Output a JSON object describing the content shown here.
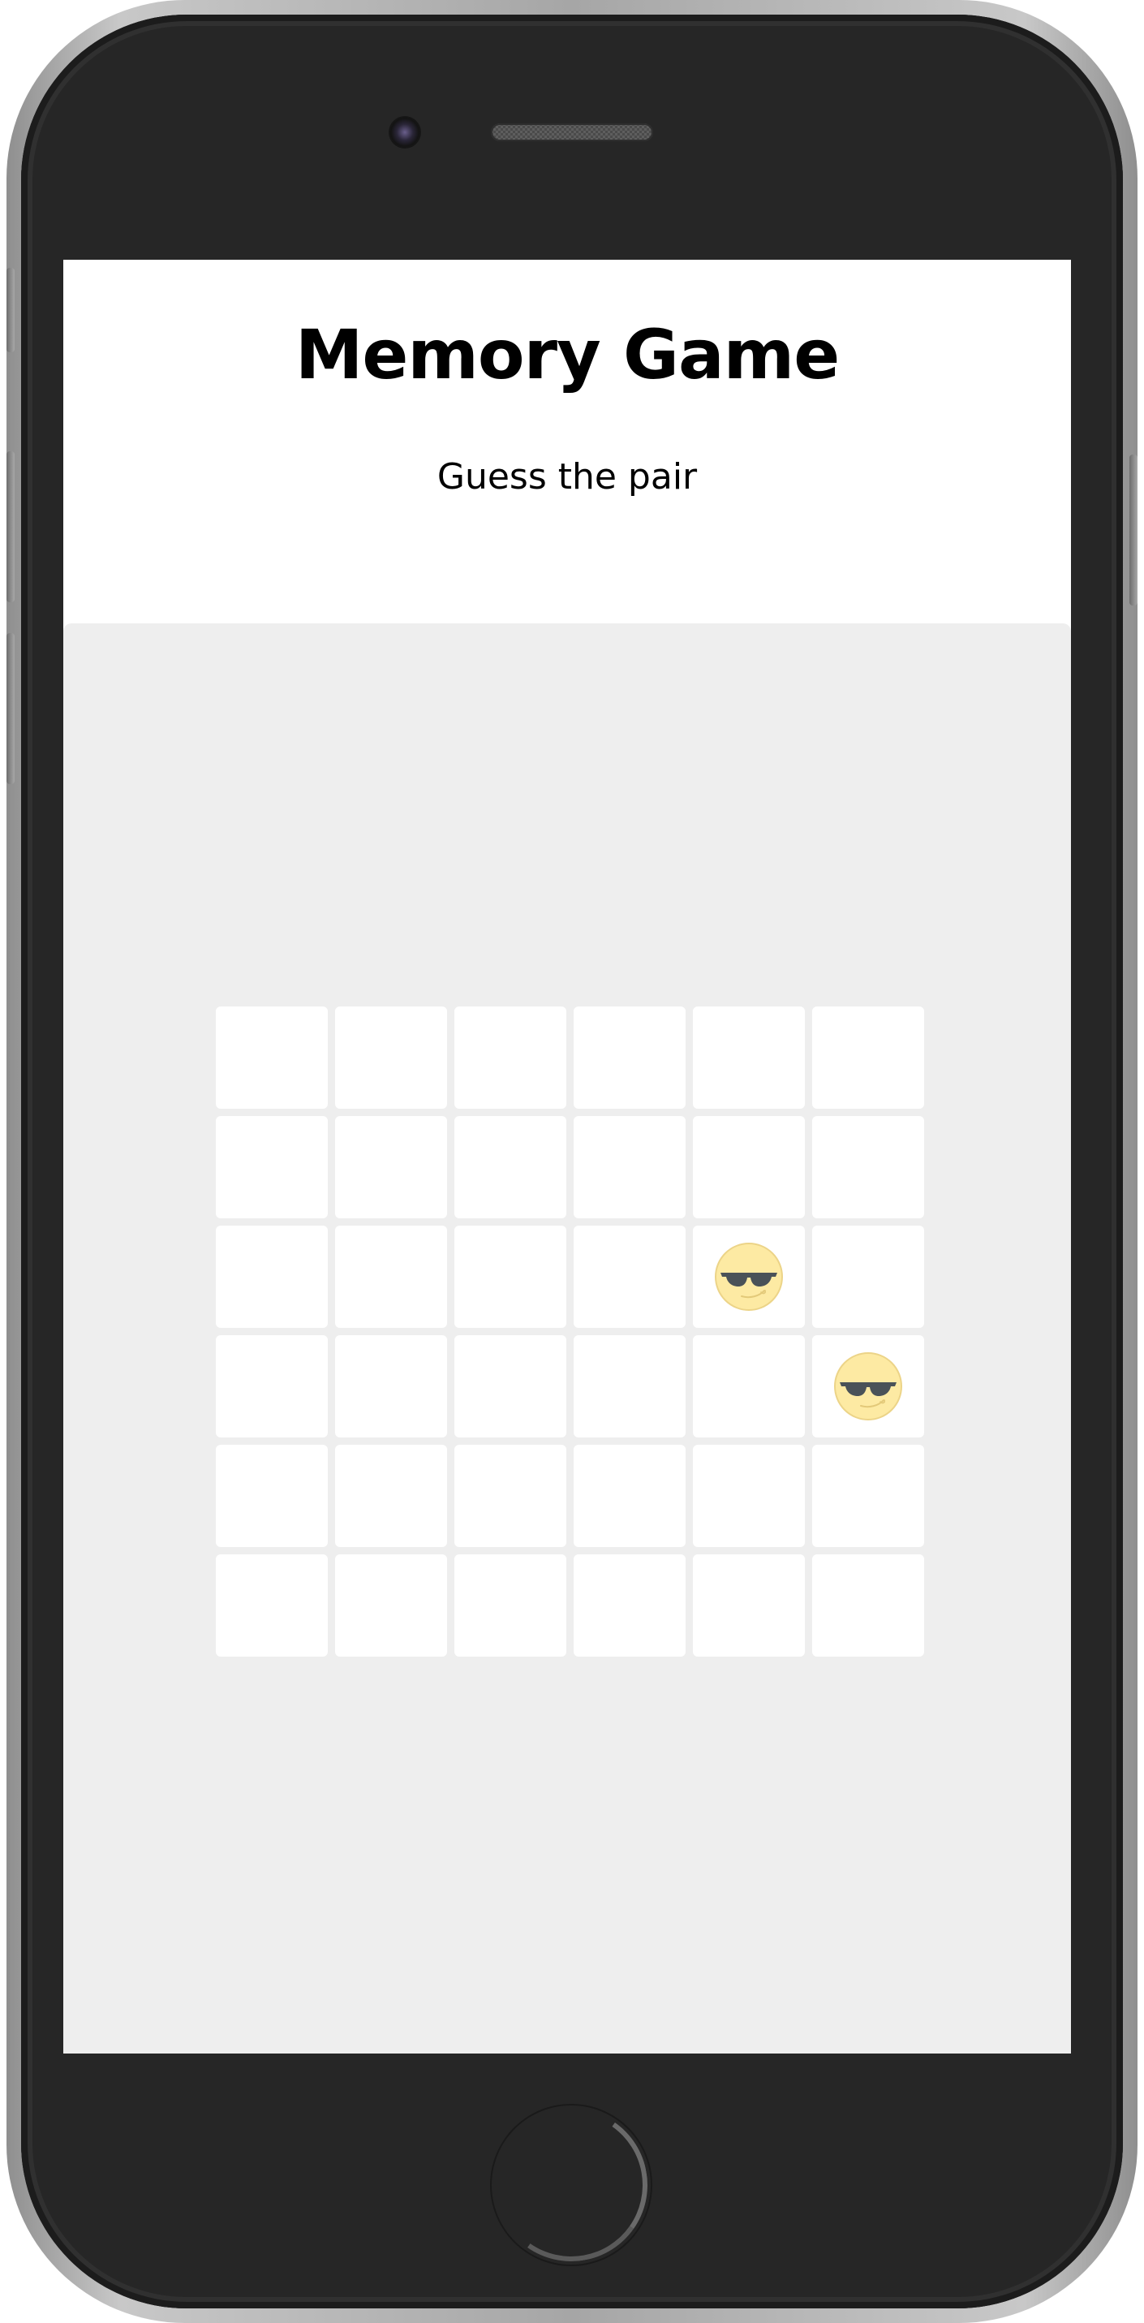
{
  "header": {
    "title": "Memory Game",
    "subtitle": "Guess the pair"
  },
  "board": {
    "rows": 6,
    "columns": 6,
    "cards": [
      {
        "revealed": false
      },
      {
        "revealed": false
      },
      {
        "revealed": false
      },
      {
        "revealed": false
      },
      {
        "revealed": false
      },
      {
        "revealed": false
      },
      {
        "revealed": false
      },
      {
        "revealed": false
      },
      {
        "revealed": false
      },
      {
        "revealed": false
      },
      {
        "revealed": false
      },
      {
        "revealed": false
      },
      {
        "revealed": false
      },
      {
        "revealed": false
      },
      {
        "revealed": false
      },
      {
        "revealed": false
      },
      {
        "revealed": true,
        "icon": "sunglasses-face-icon"
      },
      {
        "revealed": false
      },
      {
        "revealed": false
      },
      {
        "revealed": false
      },
      {
        "revealed": false
      },
      {
        "revealed": false
      },
      {
        "revealed": false
      },
      {
        "revealed": true,
        "icon": "sunglasses-face-icon"
      },
      {
        "revealed": false
      },
      {
        "revealed": false
      },
      {
        "revealed": false
      },
      {
        "revealed": false
      },
      {
        "revealed": false
      },
      {
        "revealed": false
      },
      {
        "revealed": false
      },
      {
        "revealed": false
      },
      {
        "revealed": false
      },
      {
        "revealed": false
      },
      {
        "revealed": false
      },
      {
        "revealed": false
      }
    ]
  },
  "colors": {
    "board_background": "#eeeeee",
    "card_background": "#ffffff",
    "face_fill": "#fdeaa3",
    "face_outline": "#ecd488",
    "sunglasses": "#4a5258"
  }
}
